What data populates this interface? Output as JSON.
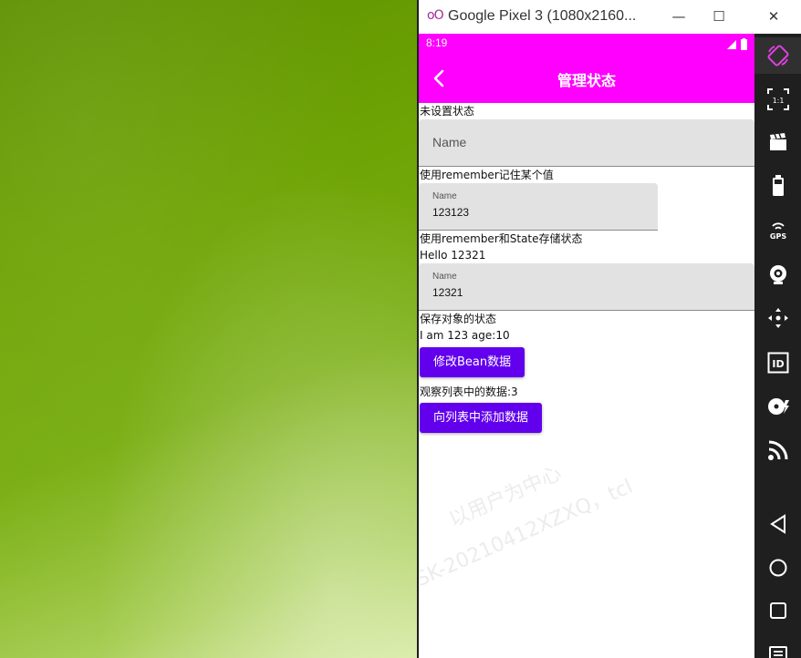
{
  "window": {
    "logo": "oO",
    "title": "Google Pixel 3 (1080x2160...",
    "minimize": "—",
    "maximize": "☐",
    "close": "✕"
  },
  "status": {
    "time": "8:19"
  },
  "appbar": {
    "title": "管理状态"
  },
  "sections": {
    "unset": {
      "label": "未设置状态",
      "placeholder": "Name"
    },
    "remember": {
      "label": "使用remember记住某个值",
      "field_label": "Name",
      "field_value": "123123"
    },
    "state": {
      "label": "使用remember和State存储状态",
      "hello": "Hello 12321",
      "field_label": "Name",
      "field_value": "12321"
    },
    "bean": {
      "label": "保存对象的状态",
      "info": "I am 123 age:10",
      "button": "修改Bean数据"
    },
    "list": {
      "label": "观察列表中的数据:3",
      "button": "向列表中添加数据"
    }
  },
  "watermark": {
    "line1": "以用户为中心",
    "line2": "SK-20210412XZXQ，tcl"
  },
  "toolbar": {
    "icons": [
      "rotate-icon",
      "resize-icon",
      "screenrecord-icon",
      "battery-icon",
      "gps-icon",
      "camera-icon",
      "dpad-icon",
      "id-icon",
      "fingerprint-icon",
      "cellular-icon",
      "back-icon",
      "home-icon",
      "overview-icon",
      "menu-icon"
    ],
    "gps_label": "GPS",
    "id_label": "ID",
    "resize_label": "1:1"
  },
  "colors": {
    "appbar": "#ff00ff",
    "button": "#6200ee",
    "field": "#e2e2e2"
  }
}
